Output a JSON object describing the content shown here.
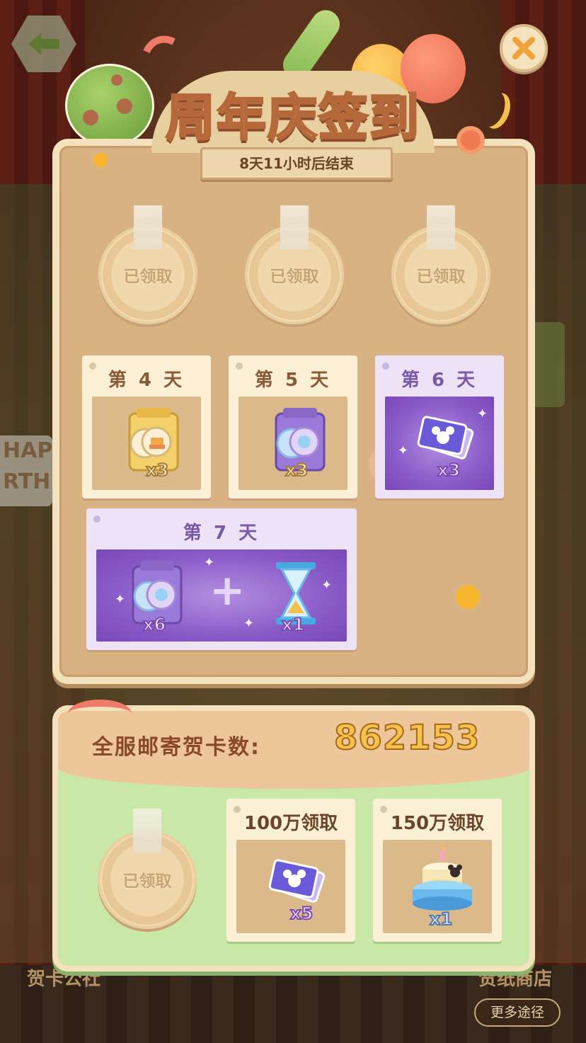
{
  "header": {
    "title": "周年庆签到",
    "timer": "8天11小时后结束"
  },
  "controls": {
    "back_icon": "arrow-left-icon",
    "close_icon": "close-icon"
  },
  "claimed_text": "已领取",
  "days_claimed": [
    {
      "status": "已领取"
    },
    {
      "status": "已领取"
    },
    {
      "status": "已领取"
    }
  ],
  "day_rewards": [
    {
      "label": "第 4 天",
      "reward": "cake-token-pack-icon",
      "qty": "x3",
      "theme": "gold"
    },
    {
      "label": "第 5 天",
      "reward": "rainbow-token-pack-icon",
      "qty": "x3",
      "theme": "gold"
    },
    {
      "label": "第 6 天",
      "reward": "mickey-card-pack-icon",
      "qty": "x3",
      "theme": "purple"
    },
    {
      "label": "第 7 天",
      "rewards": [
        {
          "icon": "rainbow-token-pack-icon",
          "qty": "x6"
        },
        {
          "icon": "hourglass-icon",
          "qty": "x1"
        }
      ],
      "theme": "purple"
    }
  ],
  "server_total": {
    "label": "全服邮寄贺卡数:",
    "value": "862153"
  },
  "milestones": [
    {
      "label": "已领取",
      "status": "claimed"
    },
    {
      "label": "100万领取",
      "reward": "mickey-card-pack-icon",
      "qty": "x5"
    },
    {
      "label": "150万领取",
      "reward": "birthday-cake-icon",
      "qty": "x1"
    }
  ],
  "background": {
    "more_ways": "更多途径",
    "left_sign": "HAP\nRTH",
    "left_bottom_label": "贺卡公社",
    "right_bottom_label": "贺纸商店"
  },
  "colors": {
    "board": "#d9b283",
    "board_border": "#f4e1bd",
    "bottom_panel": "#c9e8a8",
    "count_value": "#f6c24a",
    "purple_card": "#ede2f6"
  }
}
